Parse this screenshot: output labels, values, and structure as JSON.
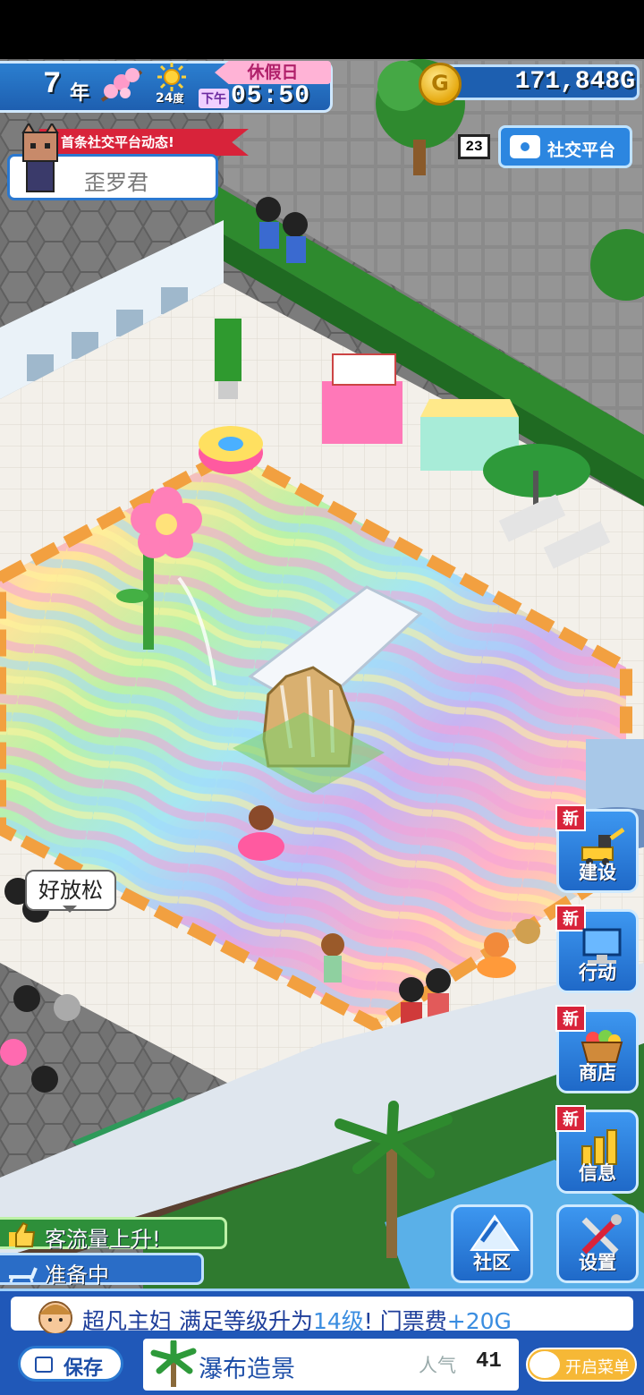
{
  "hud": {
    "year_num": "7",
    "year_label": "年",
    "temperature": "24",
    "temperature_unit": "度",
    "am_pm": "下午",
    "time": "05:50",
    "day_type": "休假日",
    "money": "171,848G"
  },
  "social": {
    "count": "23",
    "button_label": "社交平台"
  },
  "notice": {
    "title": "首条社交平台动态!",
    "name": "歪罗君"
  },
  "speech": {
    "text": "好放松"
  },
  "side_menu": [
    {
      "label": "建设",
      "badge": "新"
    },
    {
      "label": "行动",
      "badge": "新"
    },
    {
      "label": "商店",
      "badge": "新"
    },
    {
      "label": "信息",
      "badge": "新"
    }
  ],
  "bottom_buttons": {
    "community": "社区",
    "settings": "设置"
  },
  "status": {
    "visitors": "客流量上升!",
    "preparing": "准备中"
  },
  "ticker": {
    "prefix": "超凡主妇 满足等级升为",
    "level": "14级",
    "middle": "! 门票费",
    "fee": "+20G"
  },
  "bottom": {
    "save": "保存",
    "building": "瀑布造景",
    "popularity_label": "人气",
    "popularity_value": "41",
    "menu_toggle": "开启菜单"
  },
  "colors": {
    "ui_blue": "#2058b8",
    "badge_red": "#d8233a",
    "status_green": "#2e8f3a",
    "toggle_orange": "#f6b836"
  }
}
